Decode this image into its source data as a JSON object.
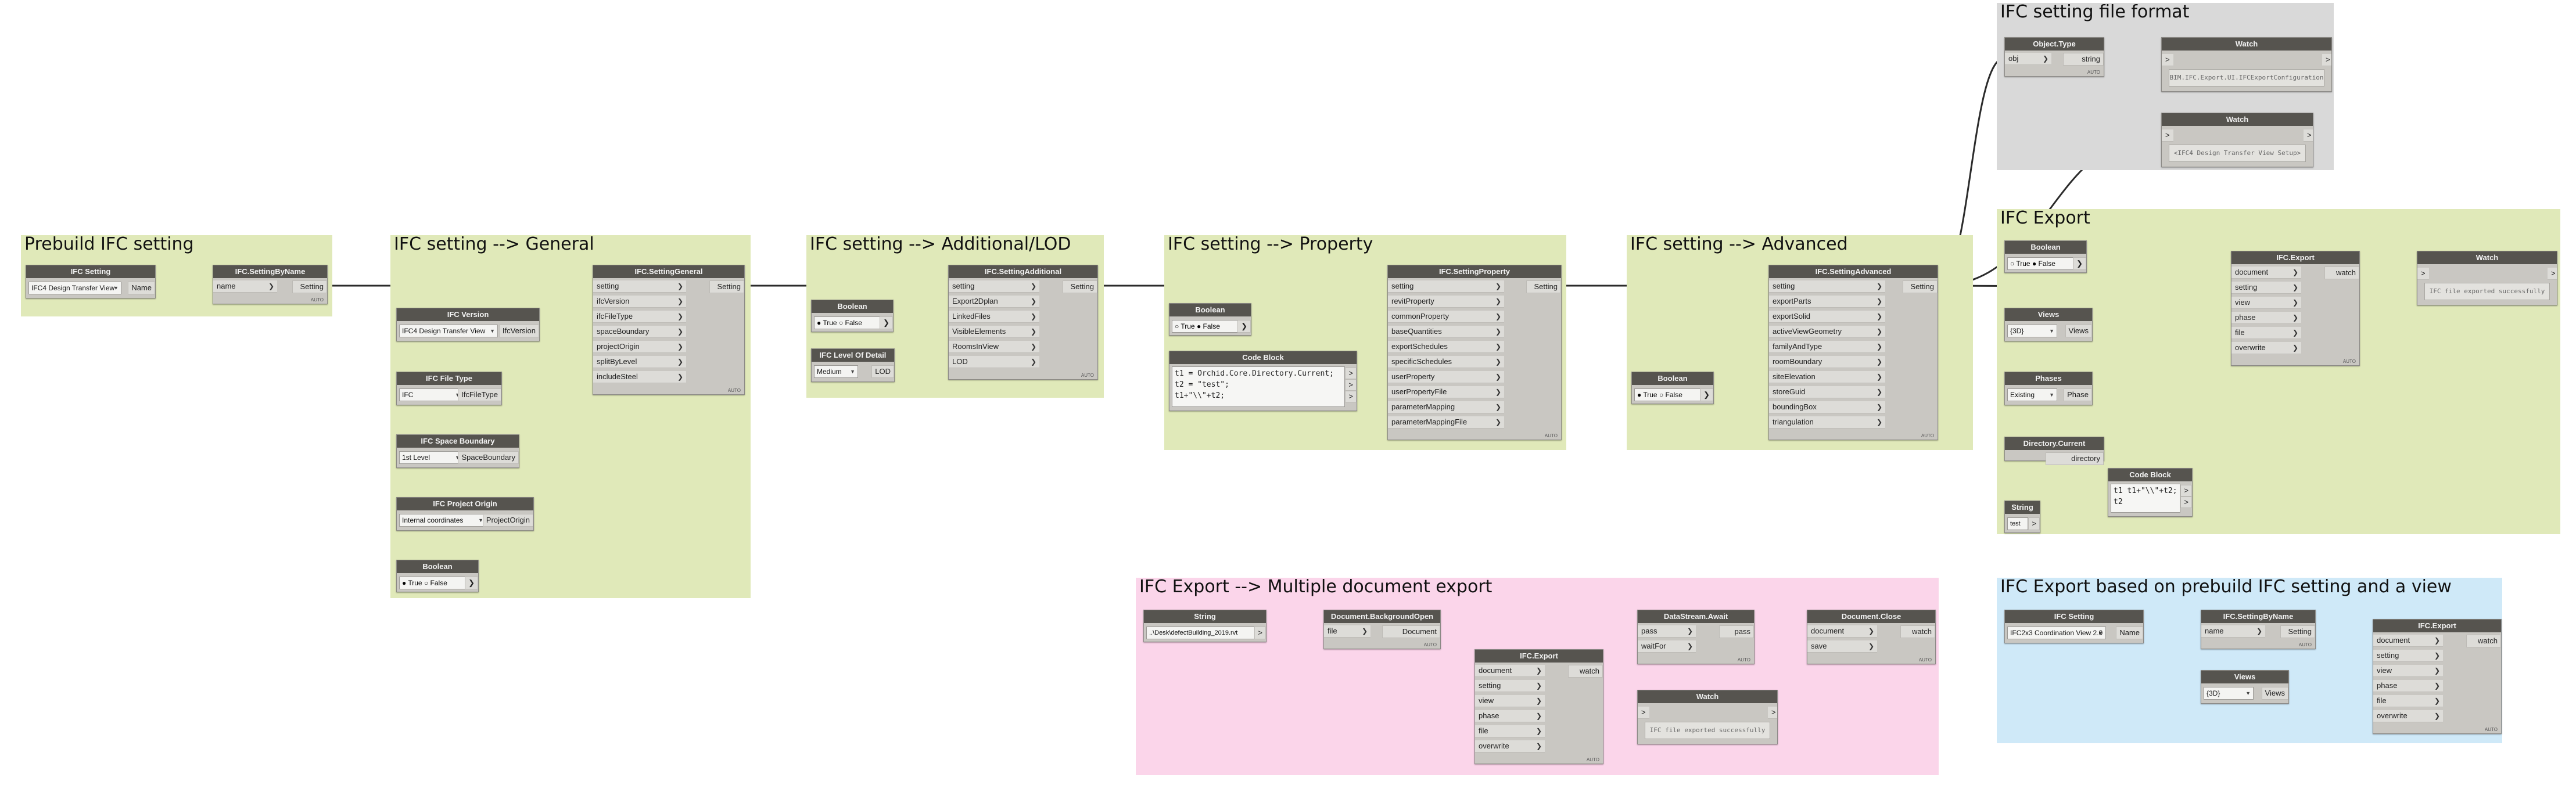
{
  "groups": {
    "prebuild": {
      "title": "Prebuild IFC setting",
      "color": "#e0e9b9"
    },
    "general": {
      "title": "IFC setting --> General",
      "color": "#e0e9b9"
    },
    "additional": {
      "title": "IFC setting --> Additional/LOD",
      "color": "#e0e9b9"
    },
    "property": {
      "title": "IFC setting --> Property",
      "color": "#e0e9b9"
    },
    "advanced": {
      "title": "IFC setting --> Advanced",
      "color": "#e0e9b9"
    },
    "fileformat": {
      "title": "IFC setting file format",
      "color": "#d9d9d9"
    },
    "export": {
      "title": "IFC Export",
      "color": "#e0e9b9"
    },
    "multi": {
      "title": "IFC Export --> Multiple document export",
      "color": "#fbd5ea"
    },
    "byview": {
      "title": "IFC Export based on prebuild IFC setting and a view",
      "color": "#cfe9f8"
    }
  },
  "nodes": {
    "ifc_setting_1": {
      "title": "IFC Setting",
      "value": "IFC4 Design Transfer View",
      "output": "Name"
    },
    "setting_by_name_1": {
      "title": "IFC.SettingByName",
      "input": "name",
      "output": "Setting",
      "foot": "AUTO"
    },
    "setting_general": {
      "title": "IFC.SettingGeneral",
      "inputs": [
        "setting",
        "ifcVersion",
        "ifcFileType",
        "spaceBoundary",
        "projectOrigin",
        "splitByLevel",
        "includeSteel"
      ],
      "output": "Setting",
      "foot": "AUTO"
    },
    "ifc_version": {
      "title": "IFC Version",
      "value": "IFC4 Design Transfer View",
      "output": "IfcVersion"
    },
    "ifc_file_type": {
      "title": "IFC File Type",
      "value": "IFC",
      "output": "IfcFileType"
    },
    "space_boundary": {
      "title": "IFC Space Boundary",
      "value": "1st Level",
      "output": "SpaceBoundary"
    },
    "project_origin": {
      "title": "IFC Project Origin",
      "value": "Internal coordinates",
      "output": "ProjectOrigin"
    },
    "boolean_general": {
      "title": "Boolean",
      "true_label": "True",
      "false_label": "False"
    },
    "setting_additional": {
      "title": "IFC.SettingAdditional",
      "inputs": [
        "setting",
        "Export2Dplan",
        "LinkedFiles",
        "VisibleElements",
        "RoomsInView",
        "LOD"
      ],
      "output": "Setting",
      "foot": "AUTO"
    },
    "boolean_additional": {
      "title": "Boolean",
      "true_label": "True",
      "false_label": "False"
    },
    "lod": {
      "title": "IFC Level Of Detail",
      "value": "Medium",
      "output": "LOD"
    },
    "setting_property": {
      "title": "IFC.SettingProperty",
      "inputs": [
        "setting",
        "revitProperty",
        "commonProperty",
        "baseQuantities",
        "exportSchedules",
        "specificSchedules",
        "userProperty",
        "userPropertyFile",
        "parameterMapping",
        "parameterMappingFile"
      ],
      "output": "Setting",
      "foot": "AUTO"
    },
    "boolean_property": {
      "title": "Boolean",
      "true_label": "True",
      "false_label": "False"
    },
    "code_block_property": {
      "title": "Code Block",
      "lines": [
        "t1 = Orchid.Core.Directory.Current;",
        "t2 = \"test\";",
        "t1+\"\\\\\"+t2;"
      ]
    },
    "setting_advanced": {
      "title": "IFC.SettingAdvanced",
      "inputs": [
        "setting",
        "exportParts",
        "exportSolid",
        "activeViewGeometry",
        "familyAndType",
        "roomBoundary",
        "siteElevation",
        "storeGuid",
        "boundingBox",
        "triangulation"
      ],
      "output": "Setting",
      "foot": "AUTO"
    },
    "boolean_advanced": {
      "title": "Boolean",
      "true_label": "True",
      "false_label": "False"
    },
    "object_type": {
      "title": "Object.Type",
      "input": "obj",
      "output": "string",
      "foot": "AUTO"
    },
    "watch_type": {
      "title": "Watch",
      "text": "BIM.IFC.Export.UI.IFCExportConfiguration"
    },
    "watch_setup": {
      "title": "Watch",
      "text": "<IFC4 Design Transfer View Setup>"
    },
    "boolean_export": {
      "title": "Boolean",
      "true_label": "True",
      "false_label": "False"
    },
    "ifc_export": {
      "title": "IFC.Export",
      "inputs": [
        "document",
        "setting",
        "view",
        "phase",
        "file",
        "overwrite"
      ],
      "output": "watch",
      "foot": "AUTO"
    },
    "watch_export": {
      "title": "Watch",
      "text": "IFC file exported successfully"
    },
    "views_export": {
      "title": "Views",
      "value": "{3D}",
      "output": "Views"
    },
    "phases": {
      "title": "Phases",
      "value": "Existing",
      "output": "Phase"
    },
    "directory_current": {
      "title": "Directory.Current",
      "output": "directory",
      "foot": "AUTO"
    },
    "code_block_export": {
      "title": "Code Block",
      "lines": [
        "t1 t1+\"\\\\\"+t2;",
        "t2"
      ]
    },
    "string_export": {
      "title": "String",
      "value": "test"
    },
    "string_multi": {
      "title": "String",
      "value": "..\\Desk\\defectBuilding_2019.rvt"
    },
    "bg_open": {
      "title": "Document.BackgroundOpen",
      "input": "file",
      "output": "Document",
      "foot": "AUTO"
    },
    "ifc_export_multi": {
      "title": "IFC.Export",
      "inputs": [
        "document",
        "setting",
        "view",
        "phase",
        "file",
        "overwrite"
      ],
      "output": "watch",
      "foot": "AUTO"
    },
    "datastream": {
      "title": "DataStream.Await",
      "inputs": [
        "pass",
        "waitFor"
      ],
      "output": "pass",
      "foot": "AUTO"
    },
    "doc_close": {
      "title": "Document.Close",
      "inputs": [
        "document",
        "save"
      ],
      "output": "watch",
      "foot": "AUTO"
    },
    "watch_multi": {
      "title": "Watch",
      "text": "IFC file exported successfully"
    },
    "ifc_setting_2": {
      "title": "IFC Setting",
      "value": "IFC2x3 Coordination View 2.0",
      "output": "Name"
    },
    "setting_by_name_2": {
      "title": "IFC.SettingByName",
      "input": "name",
      "output": "Setting",
      "foot": "AUTO"
    },
    "views_byview": {
      "title": "Views",
      "value": "{3D}",
      "output": "Views"
    },
    "ifc_export_byview": {
      "title": "IFC.Export",
      "inputs": [
        "document",
        "setting",
        "view",
        "phase",
        "file",
        "overwrite"
      ],
      "output": "watch",
      "foot": "AUTO"
    }
  }
}
